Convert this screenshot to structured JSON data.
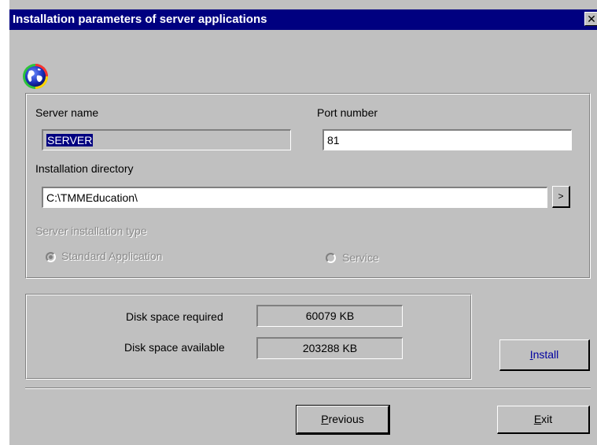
{
  "dialog": {
    "title": "Installation parameters of server applications",
    "close_symbol": "✕"
  },
  "icons": {
    "app": "globe-icon",
    "close": "close-icon"
  },
  "form": {
    "server_name_label": "Server name",
    "server_name_value": "SERVER",
    "port_label": "Port number",
    "port_value": "81",
    "install_dir_label": "Installation directory",
    "install_dir_value": "C:\\TMMEducation\\",
    "browse_label": ">",
    "install_type_label": "Server installation type",
    "radio_standard": "Standard Application",
    "radio_service": "Service",
    "selected_install_type": "Standard Application"
  },
  "disk": {
    "required_label": "Disk space required",
    "required_value": "60079 KB",
    "available_label": "Disk space available",
    "available_value": "203288 KB"
  },
  "buttons": {
    "install_prefix": "I",
    "install_rest": "nstall",
    "previous_prefix": "P",
    "previous_rest": "revious",
    "exit_prefix": "E",
    "exit_rest": "xit"
  },
  "colors": {
    "titlebar": "#000080",
    "dialog_bg": "#c0c0c0",
    "selection": "#000080",
    "install_text": "#0000a0"
  }
}
